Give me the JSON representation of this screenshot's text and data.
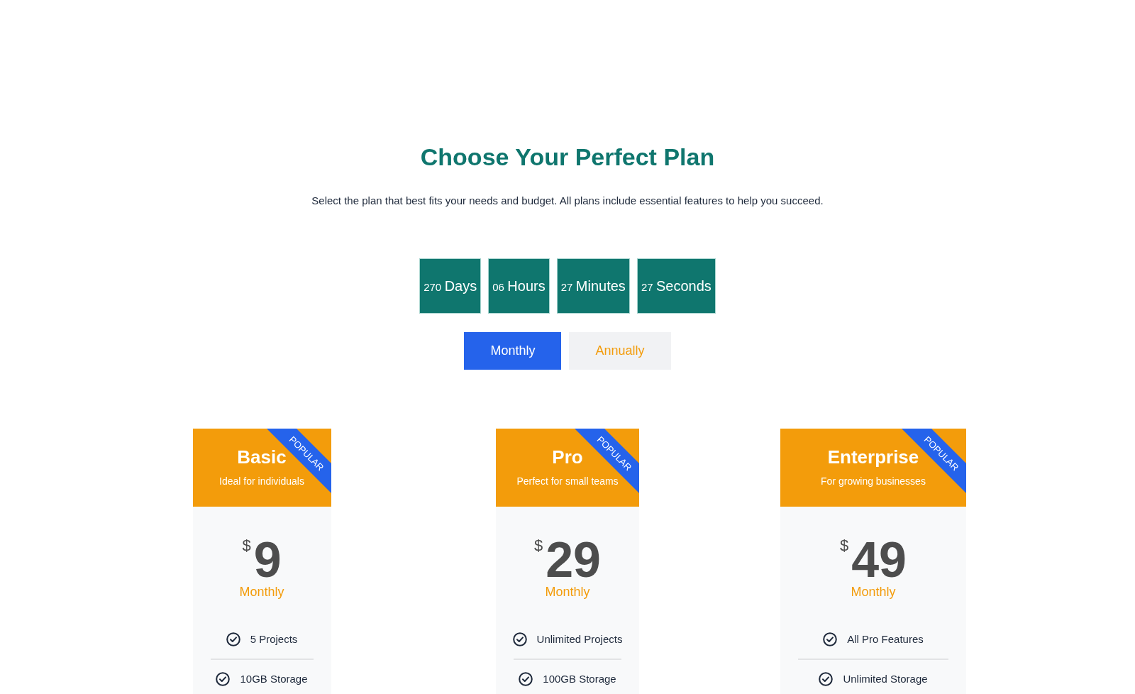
{
  "heading": {
    "title": "Choose Your Perfect Plan",
    "subtitle": "Select the plan that best fits your needs and budget. All plans include essential features to help you succeed."
  },
  "countdown": [
    {
      "value": "270",
      "unit": "Days"
    },
    {
      "value": "06",
      "unit": "Hours"
    },
    {
      "value": "27",
      "unit": "Minutes"
    },
    {
      "value": "27",
      "unit": "Seconds"
    }
  ],
  "billing_toggle": [
    {
      "label": "Monthly",
      "selected": true
    },
    {
      "label": "Annually",
      "selected": false
    }
  ],
  "plans": [
    {
      "name": "Basic",
      "tagline": "Ideal for individuals",
      "ribbon": "POPULAR",
      "currency": "$",
      "price": "9",
      "period": "Monthly",
      "features": [
        "5 Projects",
        "10GB Storage"
      ]
    },
    {
      "name": "Pro",
      "tagline": "Perfect for small teams",
      "ribbon": "POPULAR",
      "currency": "$",
      "price": "29",
      "period": "Monthly",
      "features": [
        "Unlimited Projects",
        "100GB Storage"
      ]
    },
    {
      "name": "Enterprise",
      "tagline": "For growing businesses",
      "ribbon": "POPULAR",
      "currency": "$",
      "price": "49",
      "period": "Monthly",
      "features": [
        "All Pro Features",
        "Unlimited Storage"
      ]
    }
  ]
}
